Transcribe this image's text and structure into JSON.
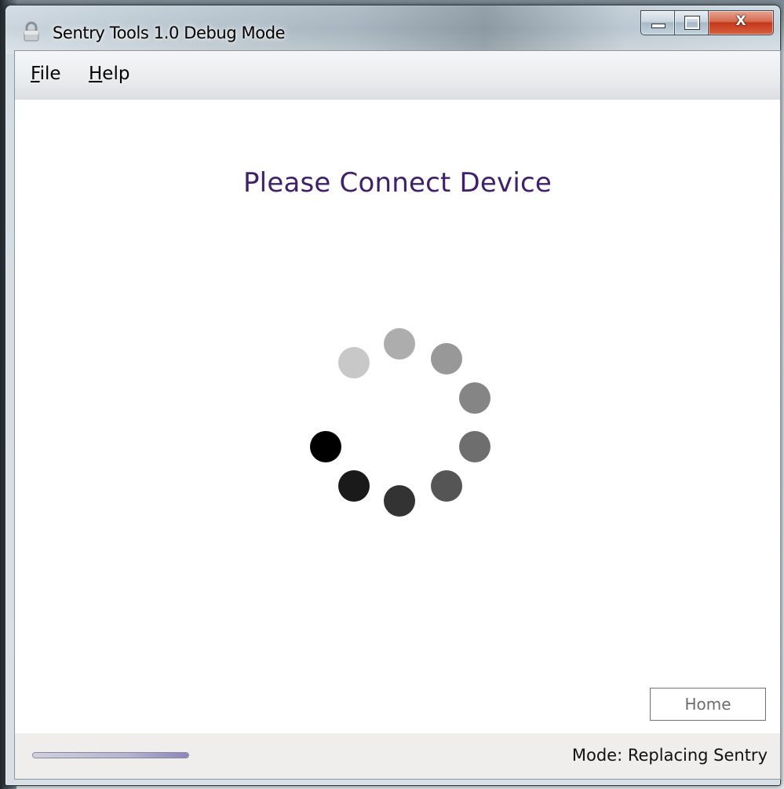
{
  "window": {
    "title": "Sentry Tools 1.0 Debug Mode",
    "app_icon": "padlock-icon",
    "caption_buttons": {
      "minimize_icon": "minimize-icon",
      "maximize_icon": "maximize-icon",
      "close_icon": "close-icon",
      "close_glyph": "X"
    }
  },
  "menu": {
    "file_accel": "F",
    "file_rest": "ile",
    "help_accel": "H",
    "help_rest": "elp"
  },
  "main": {
    "headline": "Please Connect Device",
    "headline_color": "#40206a",
    "spinner_icon": "loading-spinner-icon"
  },
  "buttons": {
    "home": "Home"
  },
  "status": {
    "mode_text": "Mode: Replacing Sentry",
    "progress_fraction": 1.0
  }
}
